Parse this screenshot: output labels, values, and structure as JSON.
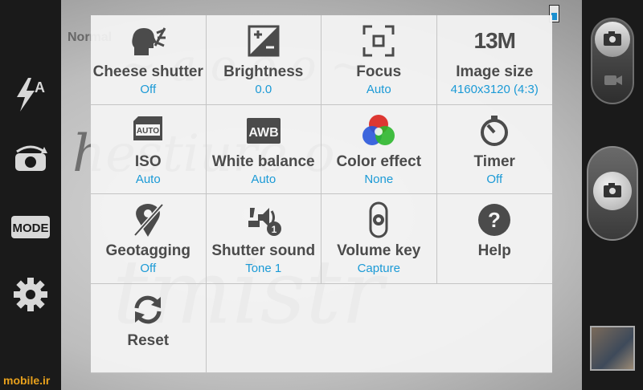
{
  "status": {
    "mode_label": "Normal"
  },
  "left_rail": {
    "icons": [
      "flash-auto-icon",
      "switch-camera-icon",
      "mode-icon",
      "settings-gear-icon"
    ],
    "mode_button": "MODE"
  },
  "settings": [
    {
      "icon": "cheese-shutter-icon",
      "label": "Cheese shutter",
      "value": "Off"
    },
    {
      "icon": "brightness-icon",
      "label": "Brightness",
      "value": "0.0"
    },
    {
      "icon": "focus-icon",
      "label": "Focus",
      "value": "Auto"
    },
    {
      "icon": "image-size-icon",
      "badge": "13M",
      "label": "Image size",
      "value": "4160x3120 (4:3)"
    },
    {
      "icon": "iso-icon",
      "badge": "AUTO",
      "label": "ISO",
      "value": "Auto"
    },
    {
      "icon": "white-balance-icon",
      "badge": "AWB",
      "label": "White balance",
      "value": "Auto"
    },
    {
      "icon": "color-effect-icon",
      "label": "Color effect",
      "value": "None"
    },
    {
      "icon": "timer-icon",
      "label": "Timer",
      "value": "Off"
    },
    {
      "icon": "geotagging-icon",
      "label": "Geotagging",
      "value": "Off"
    },
    {
      "icon": "shutter-sound-icon",
      "label": "Shutter sound",
      "value": "Tone 1"
    },
    {
      "icon": "volume-key-icon",
      "label": "Volume key",
      "value": "Capture"
    },
    {
      "icon": "help-icon",
      "label": "Help",
      "value": ""
    },
    {
      "icon": "reset-icon",
      "label": "Reset",
      "value": ""
    }
  ],
  "watermark": "mobile.ir",
  "colors": {
    "accent": "#1b9ad6",
    "label": "#4b4b4b",
    "panel": "#f4f4f4",
    "watermark": "#e8a11c"
  }
}
